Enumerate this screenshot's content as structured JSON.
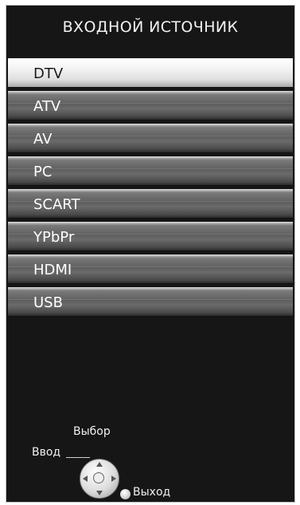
{
  "menu": {
    "title": "ВХОДНОЙ ИСТОЧНИК",
    "selected_index": 0,
    "items": [
      {
        "label": "DTV"
      },
      {
        "label": "ATV"
      },
      {
        "label": "AV"
      },
      {
        "label": "PC"
      },
      {
        "label": "SCART"
      },
      {
        "label": "YPbPr"
      },
      {
        "label": "HDMI"
      },
      {
        "label": "USB"
      }
    ]
  },
  "help": {
    "select_label": "Выбор",
    "enter_label": "Ввод",
    "exit_label": "Выход",
    "dpad_icon": "dpad-icon",
    "exit_icon": "exit-button-icon"
  }
}
